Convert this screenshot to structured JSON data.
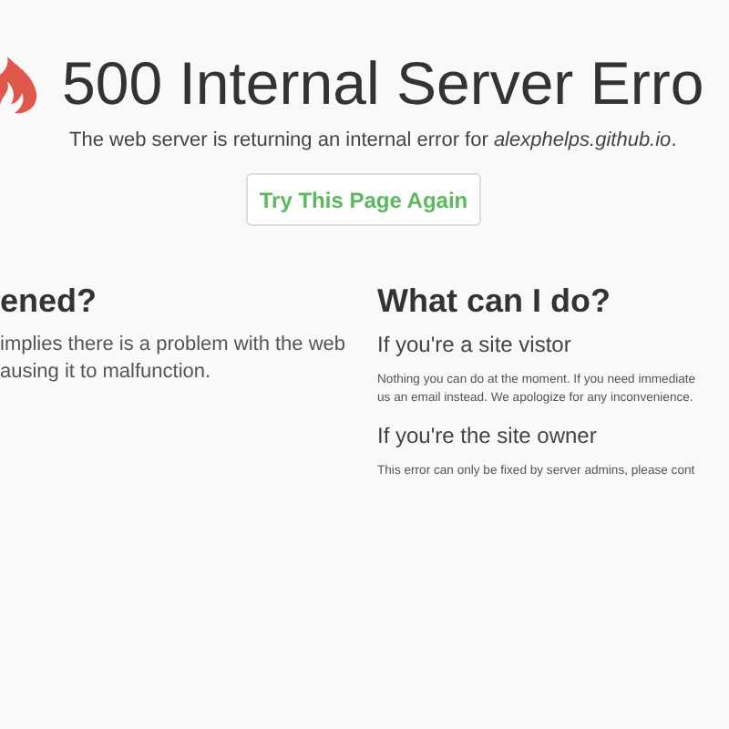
{
  "header": {
    "code": "500",
    "title": "Internal Server Erro",
    "message": "The web server is returning an internal error for *alexphelps.github.io*."
  },
  "retry_button": {
    "label": "Try This Page Again"
  },
  "left_column": {
    "heading": "ened?",
    "lines": [
      "implies there is a problem with the web",
      "ausing it to malfunction."
    ]
  },
  "right_column": {
    "heading": "What can I do?",
    "sections": [
      {
        "title": "If you're a site vistor",
        "lines": [
          "Nothing you can do at the moment. If you need immediate",
          "us an email instead. We apologize for any inconvenience."
        ]
      },
      {
        "title": "If you're the site owner",
        "lines": [
          "This error can only be fixed by server admins, please cont"
        ]
      }
    ]
  }
}
